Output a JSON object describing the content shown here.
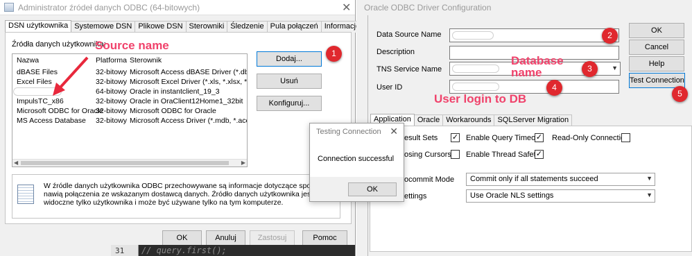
{
  "odbc_admin": {
    "title": "Administrator źródeł danych ODBC (64-bitowych)",
    "close_glyph": "✕",
    "tabs": [
      "DSN użytkownika",
      "Systemowe DSN",
      "Plikowe DSN",
      "Sterowniki",
      "Śledzenie",
      "Pula połączeń",
      "Informacje"
    ],
    "list_label": "Źródła danych użytkownika:",
    "columns": [
      "Nazwa",
      "Platforma",
      "Sterownik"
    ],
    "rows": [
      {
        "name": "dBASE Files",
        "platform": "32-bitowy",
        "driver": "Microsoft Access dBASE Driver (*.dbf, *.nd"
      },
      {
        "name": "Excel Files",
        "platform": "32-bitowy",
        "driver": "Microsoft Excel Driver (*.xls, *.xlsx, *.xlsm,"
      },
      {
        "name": "",
        "platform": "64-bitowy",
        "driver": "Oracle in instantclient_19_3"
      },
      {
        "name": "ImpulsTC_x86",
        "platform": "32-bitowy",
        "driver": "Oracle in OraClient12Home1_32bit"
      },
      {
        "name": "Microsoft ODBC for Oracle",
        "platform": "32-bitowy",
        "driver": "Microsoft ODBC for Oracle"
      },
      {
        "name": "MS Access Database",
        "platform": "32-bitowy",
        "driver": "Microsoft Access Driver (*.mdb, *.accdb)"
      }
    ],
    "buttons": {
      "add": "Dodaj...",
      "remove": "Usuń",
      "configure": "Konfiguruj..."
    },
    "info_text": "W źródle danych użytkownika ODBC przechowywane są informacje dotyczące sposobu nawią połączenia ze wskazanym dostawcą danych. Źródło danych użytkownika jest widoczne tylko użytkownika i może być używane tylko na tym komputerze.",
    "footer": {
      "ok": "OK",
      "cancel": "Anuluj",
      "apply": "Zastosuj",
      "help": "Pomoc"
    }
  },
  "code_editor": {
    "line_number": "31",
    "code": "//  query.first();"
  },
  "test_dialog": {
    "title": "Testing Connection",
    "close_glyph": "✕",
    "message": "Connection successful",
    "ok": "OK"
  },
  "oracle_config": {
    "title": "Oracle ODBC Driver Configuration",
    "fields": {
      "data_source_name": {
        "label": "Data Source Name",
        "value": ""
      },
      "description": {
        "label": "Description",
        "value": ""
      },
      "tns_service_name": {
        "label": "TNS Service Name",
        "value": ""
      },
      "user_id": {
        "label": "User ID",
        "value": ""
      }
    },
    "buttons": {
      "ok": "OK",
      "cancel": "Cancel",
      "help": "Help",
      "test": "Test Connection"
    },
    "tabs": [
      "Application",
      "Oracle",
      "Workarounds",
      "SQLServer Migration"
    ],
    "options": {
      "result_sets": {
        "label": "esult Sets",
        "checked": true
      },
      "query_timeout": {
        "label": "Enable Query Timeout",
        "checked": true
      },
      "read_only": {
        "label": "Read-Only Connection",
        "checked": false
      },
      "closing_cursors": {
        "label": "osing Cursors",
        "checked": false
      },
      "thread_safety": {
        "label": "Enable Thread Safety",
        "checked": true
      }
    },
    "check_glyph": "✓",
    "autocommit": {
      "label": "ocommit Mode",
      "value": "Commit only if all statements succeed"
    },
    "nls": {
      "label": "ettings",
      "value": "Use Oracle NLS settings"
    }
  },
  "annotations": {
    "source_name": "Source name",
    "database_name_line1": "Database",
    "database_name_line2": "name",
    "user_login": "User login to DB",
    "badges": [
      "1",
      "2",
      "3",
      "4",
      "5"
    ],
    "color": "#f0426b",
    "badge_color": "#e0282e"
  }
}
